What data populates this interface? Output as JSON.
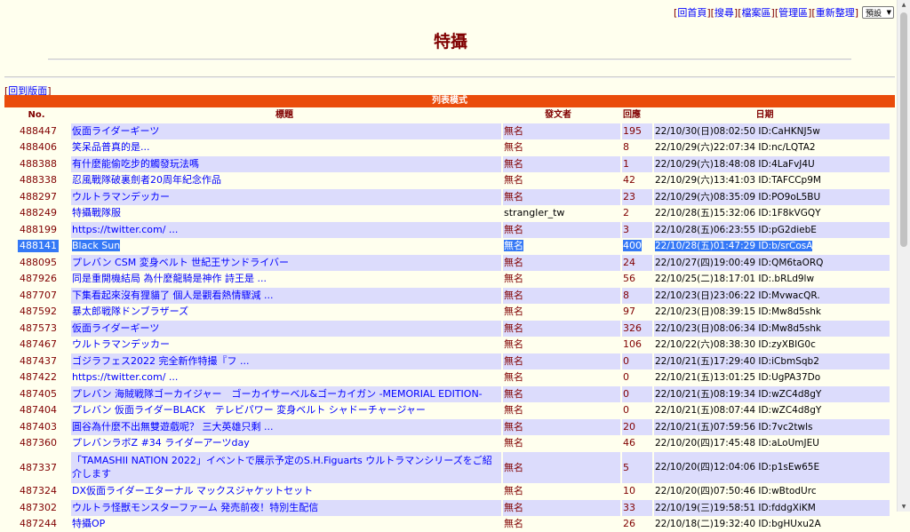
{
  "topnav": {
    "items": [
      "回首頁",
      "搜尋",
      "檔案區",
      "管理區",
      "重新整理"
    ],
    "select_value": "預設"
  },
  "page_title": "特攝",
  "back_link": "回到版面",
  "mode_bar": "列表模式",
  "headers": {
    "no": "No.",
    "title": "標題",
    "author": "發文者",
    "replies": "回應",
    "date": "日期"
  },
  "rows": [
    {
      "no": "488447",
      "title": "仮面ライダーギーツ",
      "author": "無名",
      "replies": "195",
      "date": "22/10/30(日)08:02:50 ID:CaHKNJ5w"
    },
    {
      "no": "488406",
      "title": "笑呆品普真的是...",
      "author": "無名",
      "replies": "8",
      "date": "22/10/29(六)22:07:34 ID:nc/LQTA2"
    },
    {
      "no": "488388",
      "title": "有什麼能偷吃步的觸發玩法嗎",
      "author": "無名",
      "replies": "1",
      "date": "22/10/29(六)18:48:08 ID:4LaFvJ4U"
    },
    {
      "no": "488338",
      "title": "忍風戰隊破裏劍者20周年紀念作品",
      "author": "無名",
      "replies": "42",
      "date": "22/10/29(六)13:41:03 ID:TAFCCp9M"
    },
    {
      "no": "488297",
      "title": "ウルトラマンデッカー",
      "author": "無名",
      "replies": "23",
      "date": "22/10/29(六)08:35:09 ID:PO9oL5BU"
    },
    {
      "no": "488249",
      "title": "特攝戰隊服",
      "author": "strangler_tw",
      "author_named": true,
      "replies": "2",
      "date": "22/10/28(五)15:32:06 ID:1F8kVGQY"
    },
    {
      "no": "488199",
      "title": "https://twitter.com/ ...",
      "author": "無名",
      "replies": "3",
      "date": "22/10/28(五)06:23:55 ID:pG2diebE"
    },
    {
      "no": "488141",
      "title": "Black Sun",
      "author": "無名",
      "replies": "400",
      "date": "22/10/28(五)01:47:29 ID:b/srCosA",
      "selected": true
    },
    {
      "no": "488095",
      "title": "プレバン CSM 変身ベルト 世紀王サンドライバー",
      "author": "無名",
      "replies": "24",
      "date": "22/10/27(四)19:00:49 ID:QM6taORQ"
    },
    {
      "no": "487926",
      "title": "同是重開機結局 為什麼龍騎是神作 詩王是 ...",
      "author": "無名",
      "replies": "56",
      "date": "22/10/25(二)18:17:01 ID:.bRLd9lw"
    },
    {
      "no": "487707",
      "title": "下集看起來沒有狸貓了 個人是觀看熱情驟減 ...",
      "author": "無名",
      "replies": "8",
      "date": "22/10/23(日)23:06:22 ID:MvwacQR."
    },
    {
      "no": "487592",
      "title": "暴太郎戦隊ドンブラザーズ",
      "author": "無名",
      "replies": "97",
      "date": "22/10/23(日)08:39:15 ID:Mw8d5shk"
    },
    {
      "no": "487573",
      "title": "仮面ライダーギーツ",
      "author": "無名",
      "replies": "326",
      "date": "22/10/23(日)08:06:34 ID:Mw8d5shk"
    },
    {
      "no": "487467",
      "title": "ウルトラマンデッカー",
      "author": "無名",
      "replies": "106",
      "date": "22/10/22(六)08:38:30 ID:zyXBIG0c"
    },
    {
      "no": "487437",
      "title": "ゴジラフェス2022 完全新作特撮『フ ...",
      "author": "無名",
      "replies": "0",
      "date": "22/10/21(五)17:29:40 ID:iCbmSqb2"
    },
    {
      "no": "487422",
      "title": "https://twitter.com/ ...",
      "author": "無名",
      "replies": "0",
      "date": "22/10/21(五)13:01:25 ID:UgPA37Do"
    },
    {
      "no": "487405",
      "title": "プレバン 海賊戦隊ゴーカイジャー　ゴーカイサーベル&ゴーカイガン -MEMORIAL EDITION-",
      "author": "無名",
      "replies": "0",
      "date": "22/10/21(五)08:19:34 ID:wZC4d8gY"
    },
    {
      "no": "487404",
      "title": "プレバン 仮面ライダーBLACK　テレビパワー 変身ベルト シャドーチャージャー",
      "author": "無名",
      "replies": "0",
      "date": "22/10/21(五)08:07:44 ID:wZC4d8gY"
    },
    {
      "no": "487403",
      "title": "圓谷為什麼不出無雙遊戲呢？ 三大英雄只剩 ...",
      "author": "無名",
      "replies": "20",
      "date": "22/10/21(五)07:59:56 ID:7vc2twls"
    },
    {
      "no": "487360",
      "title": "プレバンラボZ #34 ライダーアーツday",
      "author": "無名",
      "replies": "46",
      "date": "22/10/20(四)17:45:48 ID:aLoUmJEU"
    },
    {
      "no": "487337",
      "title": "「TAMASHII NATION 2022」イベントで展示予定のS.H.Figuarts ウルトラマンシリーズをご紹介します",
      "author": "無名",
      "replies": "5",
      "date": "22/10/20(四)12:04:06 ID:p1sEw65E",
      "tall": true
    },
    {
      "no": "487324",
      "title": "DX仮面ライダーエターナル マックスジャケットセット",
      "author": "無名",
      "replies": "10",
      "date": "22/10/20(四)07:50:46 ID:wBtodUrc"
    },
    {
      "no": "487302",
      "title": "ウルトラ怪獣モンスターファーム 発売前夜！特別生配信",
      "author": "無名",
      "replies": "33",
      "date": "22/10/19(三)19:58:51 ID:fddgXiKM"
    },
    {
      "no": "487244",
      "title": "特攝OP",
      "author": "無名",
      "replies": "26",
      "date": "22/10/18(二)19:32:40 ID:bgHUxu2A"
    }
  ]
}
